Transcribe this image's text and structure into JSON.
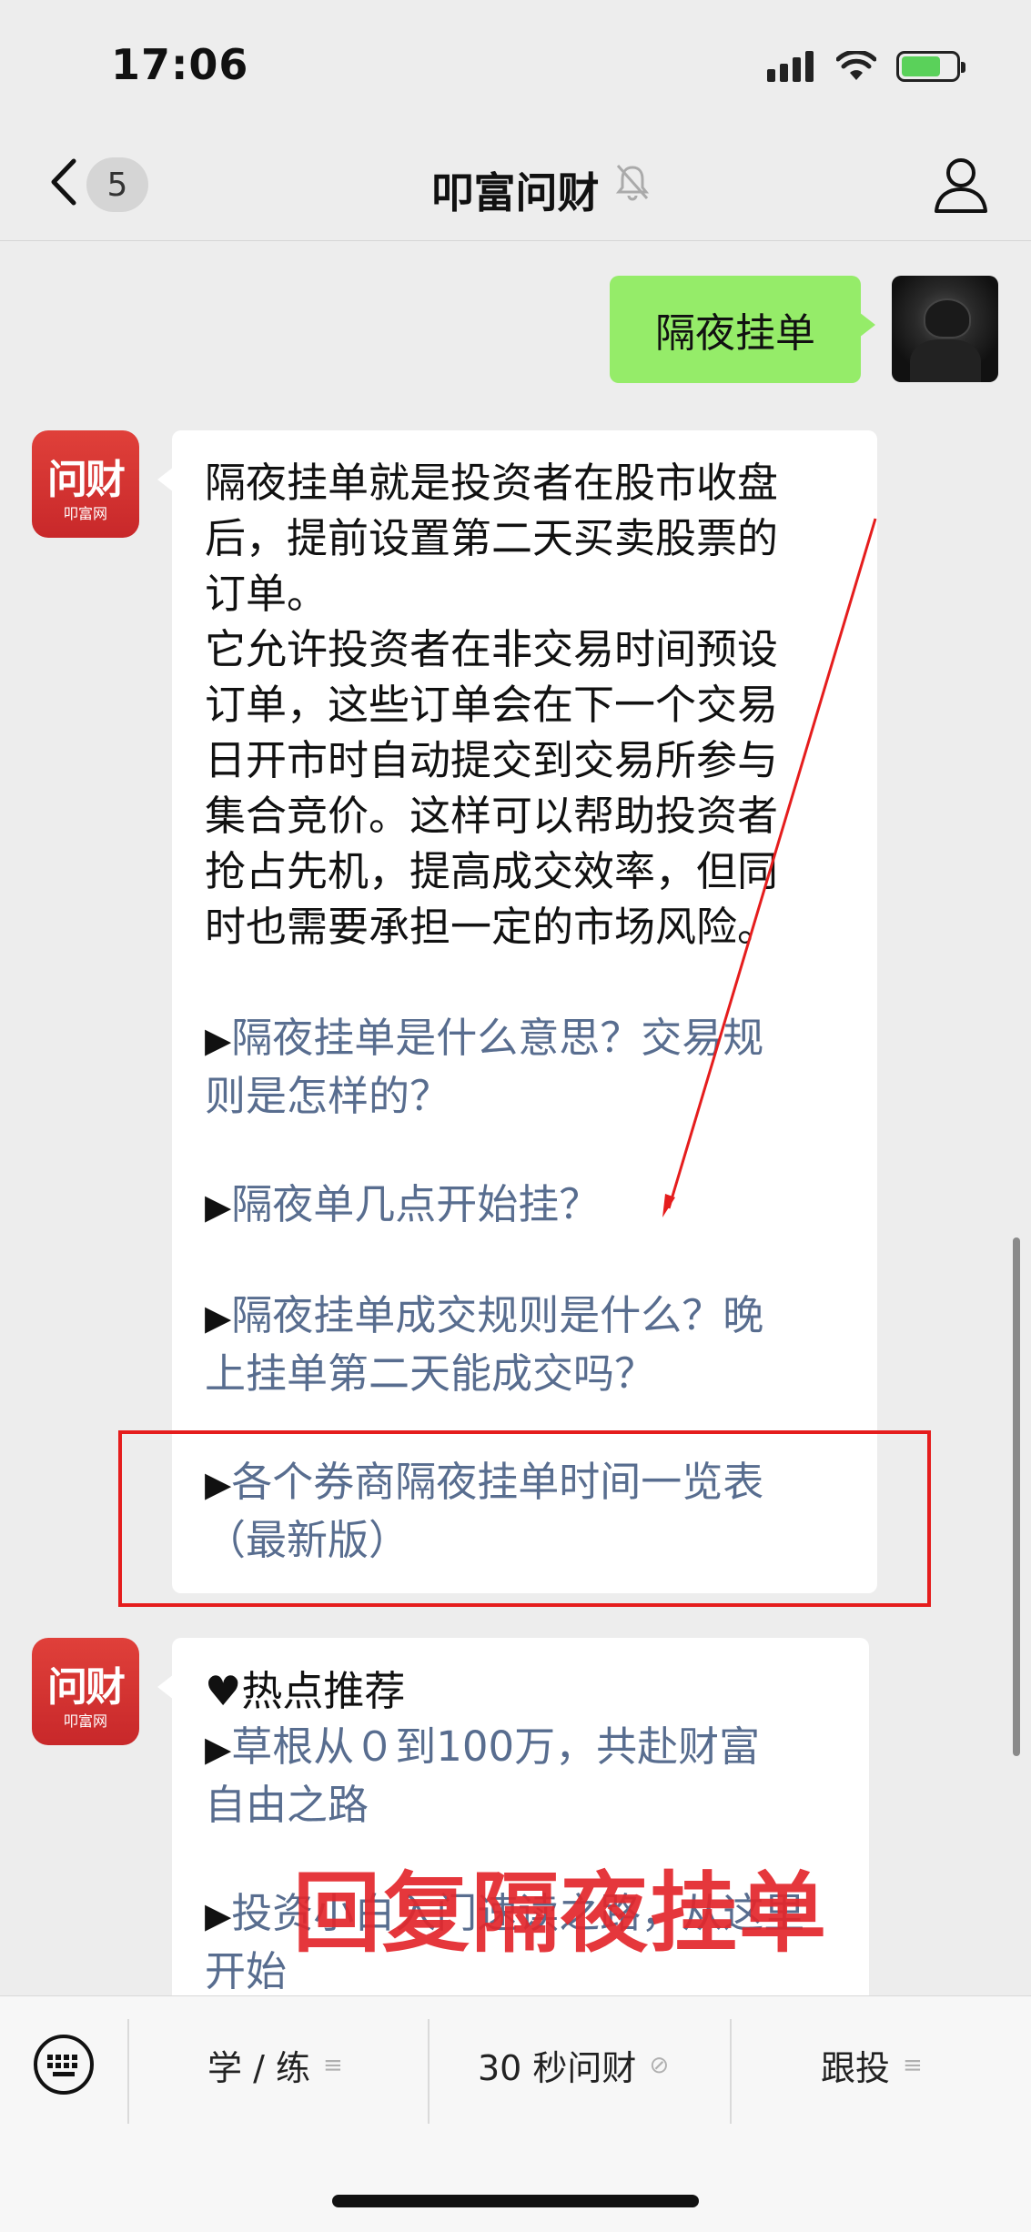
{
  "status_bar": {
    "time": "17:06"
  },
  "nav": {
    "unread_count": "5",
    "title": "叩富问财"
  },
  "chat": {
    "user_message": "隔夜挂单",
    "bot_reply_1": {
      "lines": [
        "隔夜挂单就是投资者在股市收盘",
        "后，提前设置第二天买卖股票的",
        "订单。",
        "它允许投资者在非交易时间预设",
        "订单，这些订单会在下一个交易",
        "日开市时自动提交到交易所参与",
        "集合竞价。这样可以帮助投资者",
        "抢占先机，提高成交效率，但同",
        "时也需要承担一定的市场风险。"
      ],
      "links": [
        {
          "marker": "▶",
          "lines": [
            "隔夜挂单是什么意思？交易规",
            "则是怎样的？"
          ]
        },
        {
          "marker": "▶",
          "lines": [
            "隔夜单几点开始挂？"
          ]
        },
        {
          "marker": "▶",
          "lines": [
            "隔夜挂单成交规则是什么？晚",
            "上挂单第二天能成交吗？"
          ]
        },
        {
          "marker": "▶",
          "lines": [
            "各个券商隔夜挂单时间一览表",
            "（最新版）"
          ]
        }
      ]
    },
    "bot_reply_2": {
      "heading": "热点推荐",
      "heart": "♥",
      "links": [
        {
          "marker": "▶",
          "lines": [
            "草根从０到100万，共赴财富",
            "自由之路"
          ]
        },
        {
          "marker": "▶",
          "lines": [
            "投资小白入门速读之路，从这里",
            "开始"
          ]
        }
      ]
    },
    "bot_avatar": {
      "main": "问财",
      "sub": "叩富网"
    }
  },
  "annotation": {
    "overlay_text": "回复隔夜挂单"
  },
  "bottom_menu": {
    "items": [
      {
        "label": "学 / 练",
        "icon": "≡"
      },
      {
        "label": "30 秒问财",
        "icon": "⊘"
      },
      {
        "label": "跟投",
        "icon": "≡"
      }
    ]
  },
  "colors": {
    "user_bubble": "#95ec69",
    "link": "#586d8f",
    "annotation_red": "#e51d1d"
  }
}
